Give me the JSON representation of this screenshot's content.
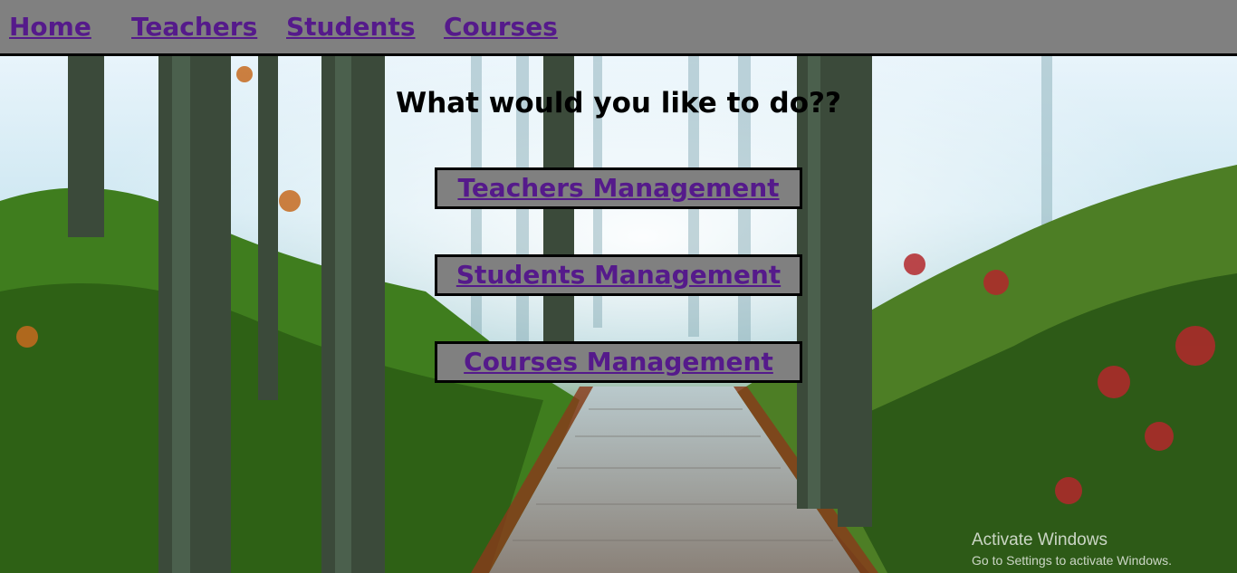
{
  "nav": {
    "items": [
      {
        "label": "Home"
      },
      {
        "label": "Teachers"
      },
      {
        "label": "Students"
      },
      {
        "label": "Courses"
      }
    ]
  },
  "main": {
    "heading": "What would you like to do??",
    "buttons": [
      {
        "label": "Teachers Management"
      },
      {
        "label": "Students Management"
      },
      {
        "label": "Courses Management"
      }
    ]
  },
  "watermark": {
    "title": "Activate Windows",
    "subtitle": "Go to Settings to activate Windows."
  },
  "colors": {
    "navbar_bg": "#808080",
    "link": "#551a8b",
    "button_bg": "#808080",
    "border": "#000000"
  }
}
